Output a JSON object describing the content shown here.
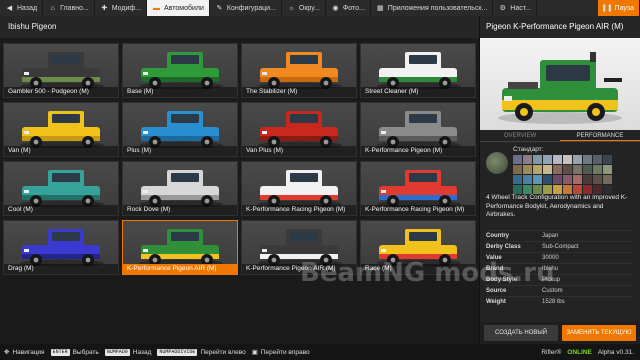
{
  "topbar": {
    "tabs": [
      {
        "label": "Назад",
        "icon": "back-arrow-icon",
        "active": false
      },
      {
        "label": "Главно...",
        "icon": "home-icon",
        "active": false
      },
      {
        "label": "Модиф...",
        "icon": "puzzle-icon",
        "active": false
      },
      {
        "label": "Автомобили",
        "icon": "car-icon",
        "active": true
      },
      {
        "label": "Конфигураци...",
        "icon": "wrench-icon",
        "active": false
      },
      {
        "label": "Окру...",
        "icon": "environment-icon",
        "active": false
      },
      {
        "label": "Фото...",
        "icon": "camera-icon",
        "active": false
      },
      {
        "label": "Приложения пользовательск...",
        "icon": "apps-icon",
        "active": false
      },
      {
        "label": "Наст...",
        "icon": "settings-icon",
        "active": false
      }
    ],
    "pause_label": "Пауза",
    "accent": "#f07800"
  },
  "left": {
    "title": "Ibishu Pigeon",
    "cards": [
      {
        "label": "Gambler 500 - Podgeon (M)",
        "body": "#3a3a3a",
        "trim": "#6d8c4a",
        "bg": "#4a4a4a"
      },
      {
        "label": "Base (M)",
        "body": "#2e9a3a",
        "trim": "#1f6a28",
        "bg": "#4a4a4a"
      },
      {
        "label": "The Stabilizer (M)",
        "body": "#f08a20",
        "trim": "#c96a10",
        "bg": "#4a4a4a"
      },
      {
        "label": "Street Cleaner (M)",
        "body": "#f1f1f1",
        "trim": "#2d8a3a",
        "bg": "#4a4a4a"
      },
      {
        "label": "Van (M)",
        "body": "#f1c21b",
        "trim": "#c49a10",
        "bg": "#4a4a4a"
      },
      {
        "label": "Plus (M)",
        "body": "#2a8fd0",
        "trim": "#1b6aa0",
        "bg": "#4a4a4a"
      },
      {
        "label": "Van Plus (M)",
        "body": "#c8281e",
        "trim": "#8e1a14",
        "bg": "#4a4a4a"
      },
      {
        "label": "K-Performance Pigeon (M)",
        "body": "#8a8a8a",
        "trim": "#5a5a5a",
        "bg": "#4a4a4a"
      },
      {
        "label": "Cool (M)",
        "body": "#36a39a",
        "trim": "#237068",
        "bg": "#4a4a4a"
      },
      {
        "label": "Rock Dove (M)",
        "body": "#d7d7d7",
        "trim": "#9a9a9a",
        "bg": "#4a4a4a"
      },
      {
        "label": "K-Performance Racing Pigeon (M)",
        "body": "#f1f1f1",
        "trim": "#e03b2e",
        "bg": "#4a4a4a"
      },
      {
        "label": "K-Performance Racing Pigeon (M)",
        "body": "#e03b2e",
        "trim": "#2a6fd0",
        "bg": "#4a4a4a"
      },
      {
        "label": "Drag (M)",
        "body": "#3a3ad0",
        "trim": "#24248a",
        "bg": "#4a4a4a"
      },
      {
        "label": "K-Performance Pigeon AIR (M)",
        "body": "#2f8f3a",
        "trim": "#f1c21b",
        "bg": "#4a4a4a",
        "selected": true
      },
      {
        "label": "K-Performance Pigeon AIR (M)",
        "body": "#3a3a3a",
        "trim": "#f1f1f1",
        "bg": "#4a4a4a"
      },
      {
        "label": "Race (M)",
        "body": "#f1c21b",
        "trim": "#e03b2e",
        "bg": "#4a4a4a"
      }
    ]
  },
  "right": {
    "title": "Pigeon K-Performance Pigeon AIR (M)",
    "tabs": [
      "OVERVIEW",
      "PERFORMANCE"
    ],
    "active_tab": "PERFORMANCE",
    "paint_label": "Стандарт:",
    "swatches": [
      "#6b6f8a",
      "#8f7b8a",
      "#7c9aa8",
      "#8fa4b5",
      "#b7b9c8",
      "#c7c1c0",
      "#9aa3ad",
      "#6e7a86",
      "#55606b",
      "#3b4652",
      "#806a4a",
      "#a08a58",
      "#b9a46a",
      "#c7b88f",
      "#8a6a5a",
      "#5d4e48",
      "#7a7468",
      "#4f5b50",
      "#6a7b62",
      "#8b9a7a",
      "#3c6a8a",
      "#4d7fa0",
      "#5b95b8",
      "#2d4f6e",
      "#6c4a6a",
      "#8a5a6a",
      "#a7686a",
      "#4a3a3a",
      "#5e5048",
      "#756a5e",
      "#2a6a5a",
      "#3a8a6a",
      "#6a8a4a",
      "#9aa04a",
      "#c8a04a",
      "#c8783a",
      "#b84a3a",
      "#8a2a2a",
      "#4a2a2a",
      "#2e2e2e"
    ],
    "description": "4 Wheel Track Configuration with an improved K-Performance Bodykit, Aerodynamics and Airbrakes.",
    "specs": [
      {
        "k": "Country",
        "v": "Japan"
      },
      {
        "k": "Derby Class",
        "v": "Sub-Compact"
      },
      {
        "k": "Value",
        "v": "30000"
      },
      {
        "k": "Brand",
        "v": "Ibishu"
      },
      {
        "k": "Body Style",
        "v": "Pickup"
      },
      {
        "k": "Source",
        "v": "Custom"
      },
      {
        "k": "Weight",
        "v": "1528 lbs"
      }
    ],
    "btn_new": "СОЗДАТЬ НОВЫЙ",
    "btn_replace": "ЗАМЕНИТЬ ТЕКУЩУЮ"
  },
  "bottombar": {
    "items": [
      {
        "key": "",
        "label": "Навигация",
        "icon": "dpad-icon"
      },
      {
        "key": "ENTER",
        "label": "Выбрать"
      },
      {
        "key": "NUMPAD0",
        "label": "Назад"
      },
      {
        "key": "NUMPADDIVIDE",
        "label": "Перейти влево"
      },
      {
        "key": "",
        "label": "Перейти вправо",
        "icon": "mouse-icon"
      }
    ],
    "user": "Rifler®",
    "status": "ONLINE",
    "version": "Alpha v0.31."
  },
  "watermark": "BeamNG mods.ru"
}
